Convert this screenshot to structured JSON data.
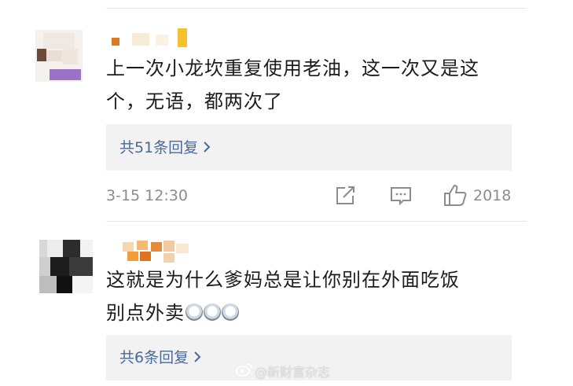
{
  "comments": [
    {
      "text_line1": "上一次小龙坎重复使用老油，这一次又是这",
      "text_line2": "个，无语，都两次了",
      "reply_label": "共51条回复",
      "timestamp": "3-15 12:30",
      "like_count": "2018"
    },
    {
      "text_line1": "这就是为什么爹妈总是让你别在外面吃饭",
      "text_line2": "别点外卖",
      "emoji_count": 3,
      "reply_label": "共6条回复"
    }
  ],
  "icons": {
    "share": "share-icon",
    "comment": "comment-icon",
    "like": "thumbs-up-icon",
    "chevron": "chevron-right-icon",
    "emoji": "shocked-face-emoji"
  },
  "watermark": {
    "text": "@新财富杂志"
  },
  "colors": {
    "link": "#4a6a9a",
    "meta": "#8c8c8c",
    "reply_bg": "#f2f2f2",
    "divider": "#e6e6e6"
  }
}
